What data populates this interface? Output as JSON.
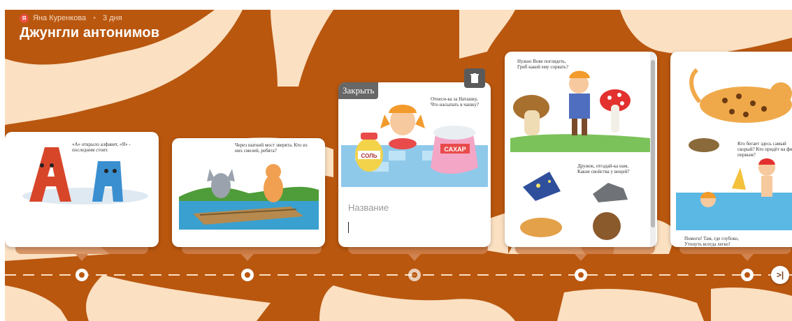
{
  "header": {
    "author_avatar_letter": "Я",
    "author_name": "Яна Куренкова",
    "separator": "•",
    "duration": "3 дня",
    "title": "Джунгли антонимов"
  },
  "colors": {
    "background": "#b9570f",
    "pattern": "#fbe0c2",
    "accent_avatar": "#e84d3d"
  },
  "cards": [
    {
      "caption": "«А» открыло алфавит, «Я» - последним стоит."
    },
    {
      "caption": "Через шаткий мост зверята. Кто из них смелей, ребята?"
    },
    {
      "caption": "Отнеси-ка за Наташку, Что насыпать в чашку?",
      "labels": [
        "СОЛЬ",
        "САХАР"
      ],
      "close_label": "Закрыть",
      "name_placeholder": "Название",
      "delete_icon": "trash-icon"
    },
    {
      "caption_top": "Нужно Вове поглядеть, Гриб какой ему сорвать?",
      "caption_mid": "Дружок, отгадай-ка нам, Какие свойства у вещей?"
    },
    {
      "caption_top": "Кто бегает здесь самый скорый? Кто придёт на финиш первым?",
      "caption_bottom": "Помоги! Там, где глубоко, Утонуть всегда легко!"
    }
  ],
  "nav": {
    "next_label": ">|"
  }
}
